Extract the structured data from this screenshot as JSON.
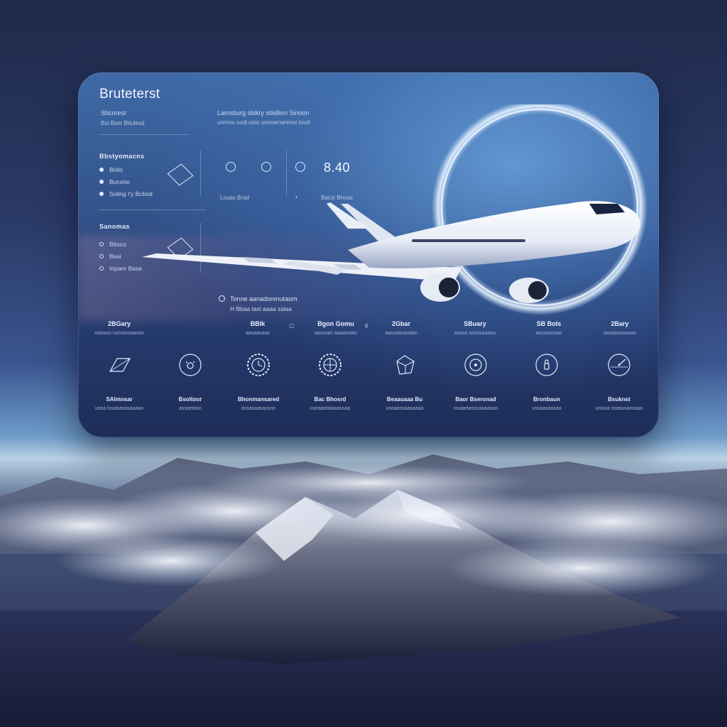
{
  "app": {
    "brand": "Bruteterst"
  },
  "header": {
    "sub_line_1": "Sbcoresr",
    "sub_line_2": "Bst Bser  Bttulesd",
    "info_line_1": "Lamsburg sbikry sbidlion Sinoon",
    "info_line_2": "unrnou sodi.usor usoxarnanmor.toud"
  },
  "group_1": {
    "title": "Bbstyomacns",
    "options": [
      {
        "label": "Bolio",
        "selected": true
      },
      {
        "label": "Bucono",
        "selected": true
      },
      {
        "label": "Soling I'y Bcbod",
        "selected": true
      }
    ]
  },
  "group_2": {
    "title": "Sanomas",
    "options": [
      {
        "label": "Bitoco",
        "selected": false
      },
      {
        "label": "Bsai",
        "selected": false
      },
      {
        "label": "Inpanr Basa",
        "selected": false
      }
    ]
  },
  "flight": {
    "time": "8.40",
    "caption_left": "Louas Brad",
    "caption_right": "Bacst Bhose",
    "note_1": "Tonne aanadonmutaom",
    "note_2": "H Bbaa lasl aaaa sslaa"
  },
  "stats": [
    {
      "value": "2BGary",
      "label": "sseisoo nsmonsaaoon"
    },
    {
      "value": "BBIk",
      "label": "aasaasaao"
    },
    {
      "value": "Bgon Gomu",
      "label": "aassaas aaaaosalu"
    },
    {
      "value": "2Gbar",
      "label": "aassaasaoaan"
    },
    {
      "value": "SBuary",
      "label": "aassa sseosaaaoa"
    },
    {
      "value": "SB Bols",
      "label": "aassaassao"
    },
    {
      "value": "2Bary",
      "label": "aasaaoaaaaaa"
    }
  ],
  "icons": [
    {
      "icon": "parallelogram-icon",
      "title": "SAlmnsar",
      "subtitle": "usoa tosasasasaaaan"
    },
    {
      "icon": "face-icon",
      "title": "Bsoltoor",
      "subtitle": "assoetaso"
    },
    {
      "icon": "clock-icon",
      "title": "Bhonmansared",
      "subtitle": "assasaasassno"
    },
    {
      "icon": "globe-icon",
      "title": "Bac Bhosrd",
      "subtitle": "oseaastalaaassaa"
    },
    {
      "icon": "box-icon",
      "title": "Beaauaaa Bu",
      "subtitle": "usoaassaasaaaa"
    },
    {
      "icon": "target-icon",
      "title": "Baor Bseronad",
      "subtitle": "osaaetasssaaaasao"
    },
    {
      "icon": "lock-icon",
      "title": "Bronbaun",
      "subtitle": "ussaasaasaa"
    },
    {
      "icon": "gauge-icon",
      "title": "Bsuknst",
      "subtitle": "ussiua ssasusanoaas"
    }
  ],
  "colors": {
    "panel_top": "#3f6aa6",
    "panel_bottom": "#1e2d58",
    "text": "#dbe6f7",
    "ring_glow": "#cfe6ff",
    "plane_body": "#f2f5fb"
  }
}
